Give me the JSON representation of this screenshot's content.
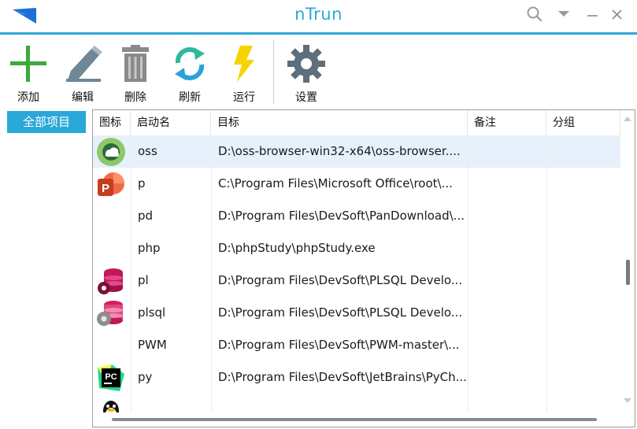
{
  "app": {
    "title": "nTrun",
    "accent_color": "#2aa8d8"
  },
  "window_controls": [
    "search-icon",
    "dropdown-icon",
    "minimize-icon",
    "close-icon"
  ],
  "toolbar": {
    "add_label": "添加",
    "edit_label": "编辑",
    "delete_label": "删除",
    "refresh_label": "刷新",
    "run_label": "运行",
    "settings_label": "设置"
  },
  "sidebar": {
    "categories": [
      {
        "label": "全部项目",
        "selected": true
      }
    ]
  },
  "table": {
    "columns": {
      "icon": "图标",
      "name": "启动名",
      "target": "目标",
      "note": "备注",
      "group": "分组"
    },
    "rows": [
      {
        "icon": "oss-browser-icon",
        "name": "oss",
        "target": "D:\\oss-browser-win32-x64\\oss-browser....",
        "note": "",
        "group": "",
        "selected": true
      },
      {
        "icon": "powerpoint-icon",
        "name": "p",
        "target": "C:\\Program Files\\Microsoft Office\\root\\...",
        "note": "",
        "group": ""
      },
      {
        "icon": "",
        "name": "pd",
        "target": "D:\\Program Files\\DevSoft\\PanDownload\\...",
        "note": "",
        "group": ""
      },
      {
        "icon": "",
        "name": "php",
        "target": "D:\\phpStudy\\phpStudy.exe",
        "note": "",
        "group": ""
      },
      {
        "icon": "database-gear-icon",
        "name": "pl",
        "target": "D:\\Program Files\\DevSoft\\PLSQL Develo...",
        "note": "",
        "group": ""
      },
      {
        "icon": "database-gear-icon",
        "name": "plsql",
        "target": "D:\\Program Files\\DevSoft\\PLSQL Develo...",
        "note": "",
        "group": ""
      },
      {
        "icon": "",
        "name": "PWM",
        "target": "D:\\Program Files\\DevSoft\\PWM-master\\...",
        "note": "",
        "group": ""
      },
      {
        "icon": "pycharm-icon",
        "name": "py",
        "target": "D:\\Program Files\\DevSoft\\JetBrains\\PyCh...",
        "note": "",
        "group": ""
      },
      {
        "icon": "qq-icon",
        "name": "",
        "target": "",
        "note": "",
        "group": ""
      }
    ]
  }
}
